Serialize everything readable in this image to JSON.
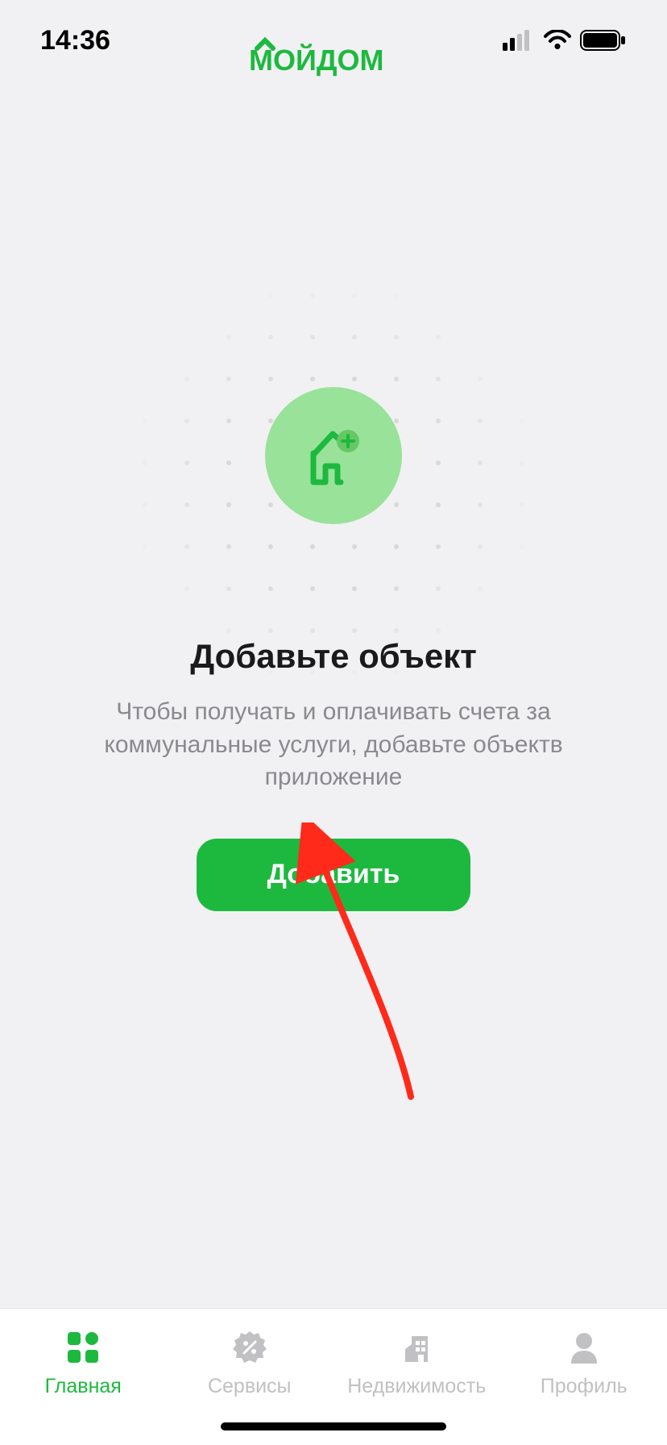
{
  "status": {
    "time": "14:36"
  },
  "logo": {
    "text": "МОЙДОМ"
  },
  "main": {
    "heading": "Добавьте объект",
    "subtext": "Чтобы получать и оплачивать счета за коммунальные услуги, добавьте объектв приложение",
    "button_label": "Добавить"
  },
  "tabs": [
    {
      "label": "Главная",
      "active": true
    },
    {
      "label": "Сервисы",
      "active": false
    },
    {
      "label": "Недвижимость",
      "active": false
    },
    {
      "label": "Профиль",
      "active": false
    }
  ],
  "colors": {
    "brand_green": "#1db93f",
    "light_green": "#99e299",
    "inactive": "#c1c1c4"
  }
}
